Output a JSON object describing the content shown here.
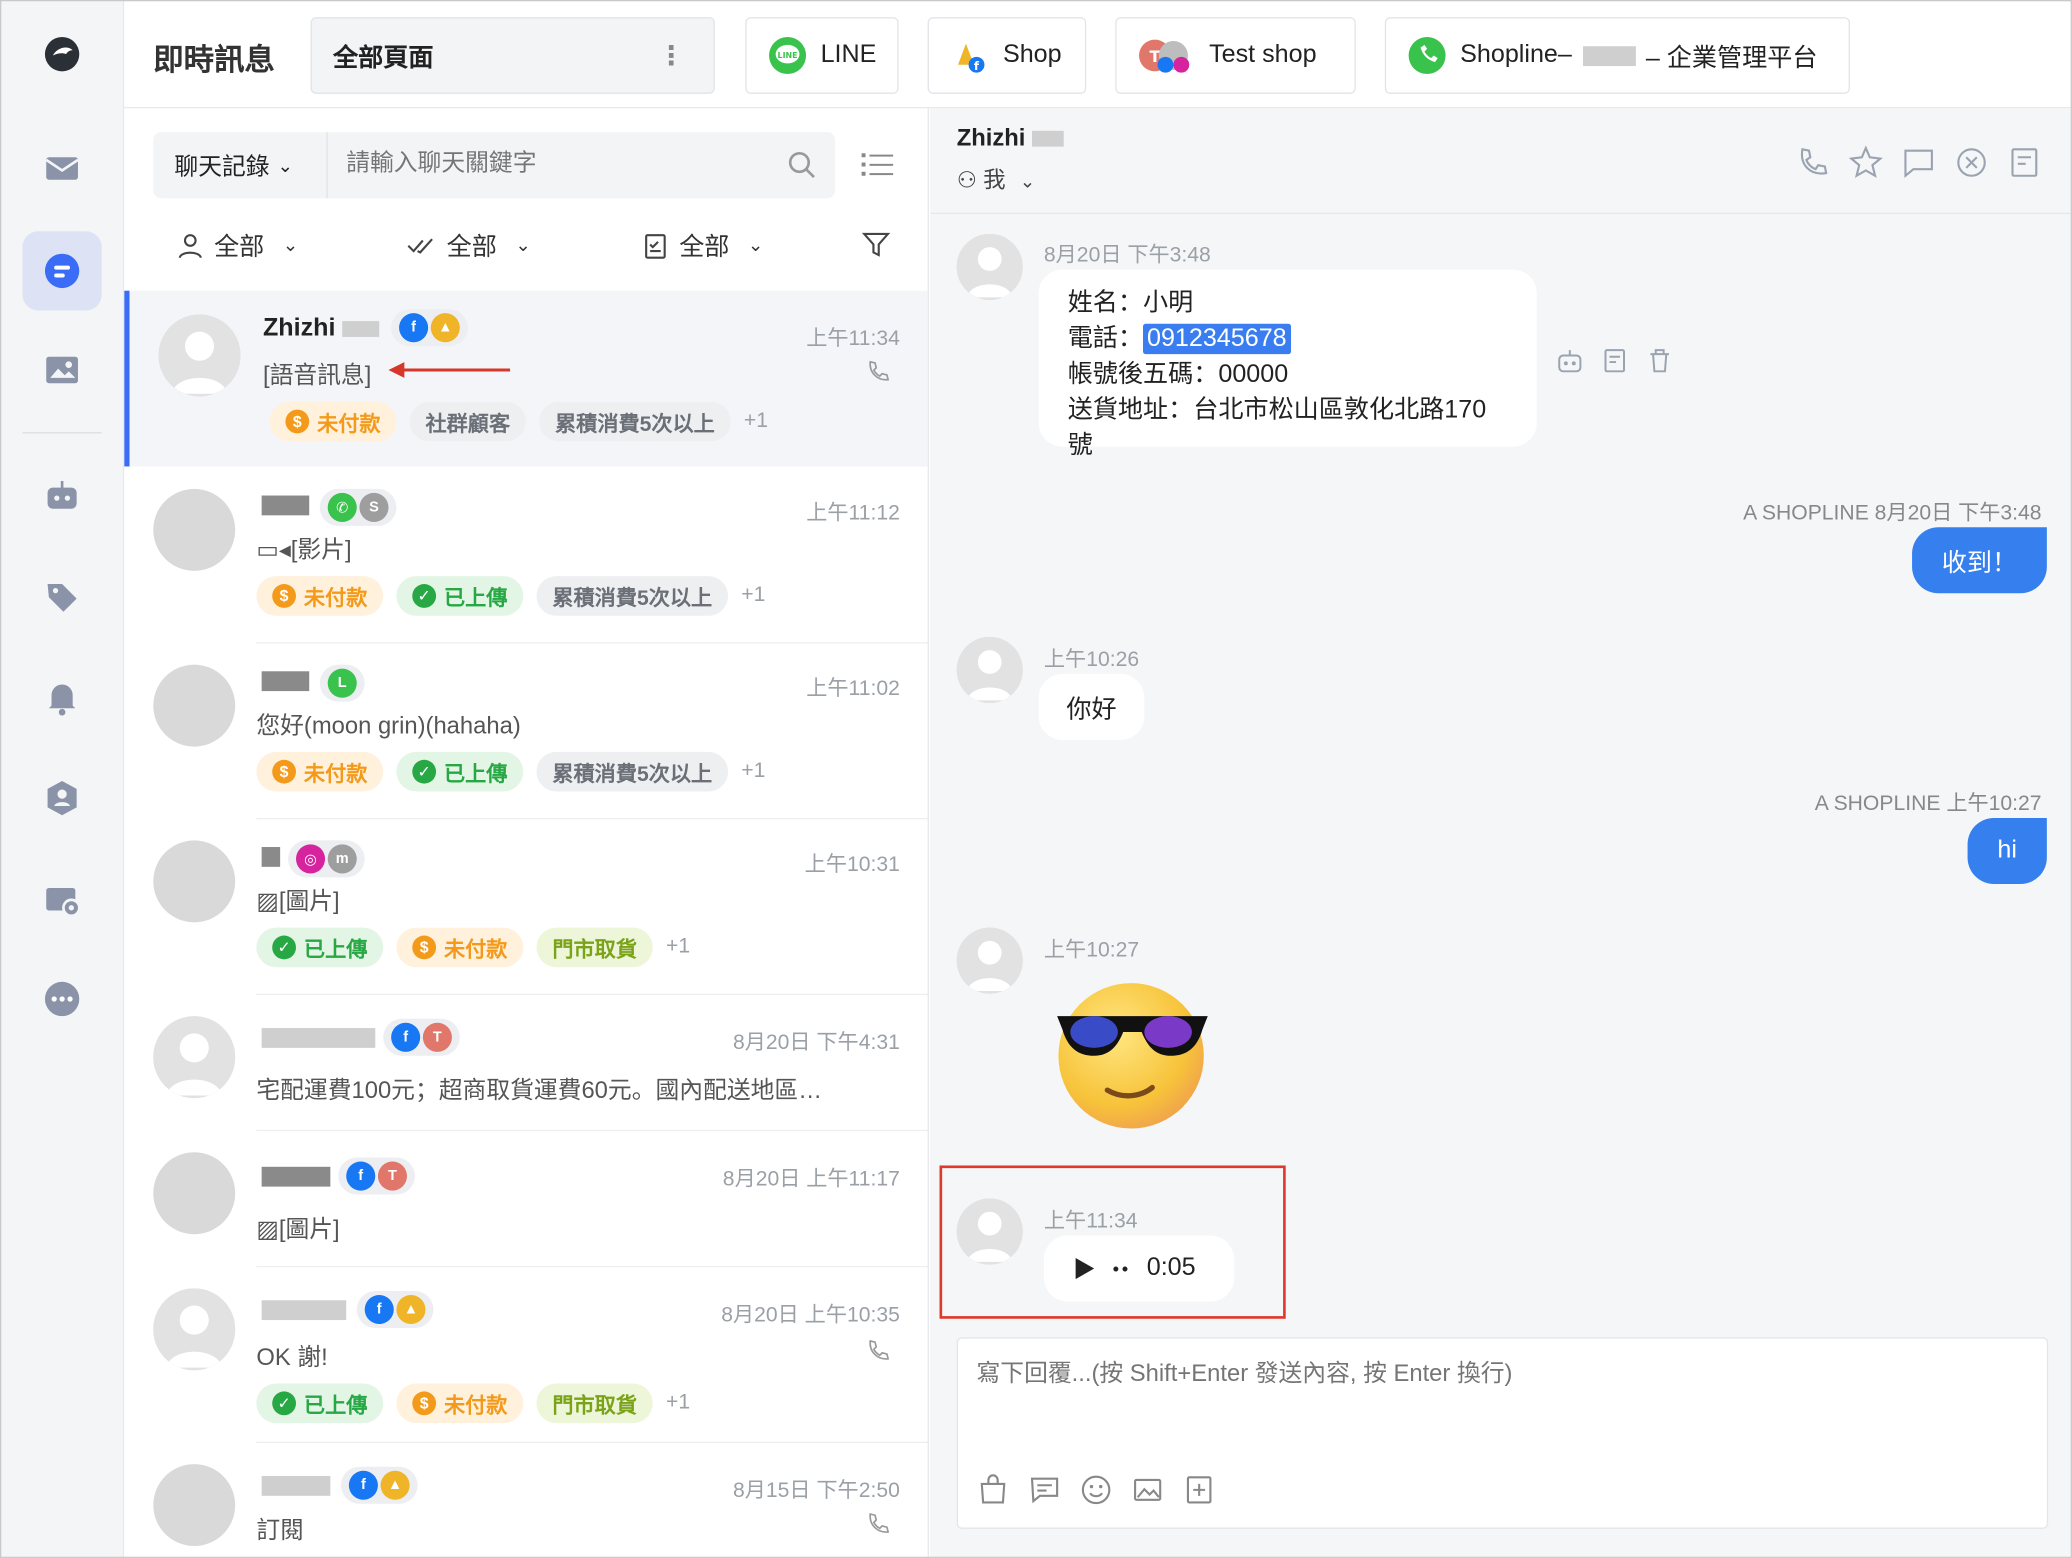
{
  "topbar": {
    "title": "即時訊息",
    "tabs": [
      {
        "label": "全部頁面",
        "icon": "more-vert-icon"
      },
      {
        "label": "LINE",
        "icon": "line-icon"
      },
      {
        "label": "Shop",
        "icon": "shop-icon"
      },
      {
        "label": "Test shop",
        "icon": "test-shop-icon"
      },
      {
        "label_left": "Shopline–",
        "label_right": "– 企業管理平台",
        "icon": "whatsapp-icon"
      }
    ]
  },
  "rail": {
    "items": [
      "logo-icon",
      "mail-icon",
      "chat-icon",
      "image-icon",
      "bot-icon",
      "tag-icon",
      "bell-icon",
      "contact-icon",
      "card-settings-icon",
      "more-icon"
    ],
    "active": "chat-icon"
  },
  "list": {
    "search_select": "聊天記錄",
    "search_placeholder": "請輸入聊天關鍵字",
    "filters": [
      "全部",
      "全部",
      "全部"
    ],
    "items": [
      {
        "name": "Zhizhi",
        "time": "上午11:34",
        "preview": "[語音訊息]",
        "tags": [
          {
            "label": "未付款",
            "type": "orange"
          },
          {
            "label": "社群顧客",
            "type": "gray"
          },
          {
            "label": "累積消費5次以上",
            "type": "gray"
          }
        ],
        "more": "+1"
      },
      {
        "name": "",
        "time": "上午11:12",
        "preview": "[影片]",
        "tags": [
          {
            "label": "未付款",
            "type": "orange"
          },
          {
            "label": "已上傳",
            "type": "green"
          },
          {
            "label": "累積消費5次以上",
            "type": "gray"
          }
        ],
        "more": "+1"
      },
      {
        "name": "",
        "time": "上午11:02",
        "preview": "您好(moon grin)(hahaha)",
        "tags": [
          {
            "label": "未付款",
            "type": "orange"
          },
          {
            "label": "已上傳",
            "type": "green"
          },
          {
            "label": "累積消費5次以上",
            "type": "gray"
          }
        ],
        "more": "+1"
      },
      {
        "name": "",
        "time": "上午10:31",
        "preview": "[圖片]",
        "tags": [
          {
            "label": "已上傳",
            "type": "green"
          },
          {
            "label": "未付款",
            "type": "orange"
          },
          {
            "label": "門市取貨",
            "type": "lime"
          }
        ],
        "more": "+1"
      },
      {
        "name": "",
        "time": "8月20日 下午4:31",
        "preview": "宅配運費100元；超商取貨運費60元。國內配送地區…",
        "tags": [],
        "more": ""
      },
      {
        "name": "",
        "time": "8月20日 上午11:17",
        "preview": "[圖片]",
        "tags": [],
        "more": ""
      },
      {
        "name": "",
        "time": "8月20日 上午10:35",
        "preview": "OK 謝!",
        "tags": [
          {
            "label": "已上傳",
            "type": "green"
          },
          {
            "label": "未付款",
            "type": "orange"
          },
          {
            "label": "門市取貨",
            "type": "lime"
          }
        ],
        "more": "+1"
      },
      {
        "name": "",
        "time": "8月15日 下午2:50",
        "preview": "訂閱",
        "tags": [],
        "more": ""
      }
    ]
  },
  "chat": {
    "name": "Zhizhi",
    "assignee": "我",
    "messages": {
      "m1_time": "8月20日 下午3:48",
      "m1_lines": {
        "name_label": "姓名：",
        "name": "小明",
        "phone_label": "電話：",
        "phone": "0912345678",
        "acct_label": "帳號後五碼：",
        "acct": "00000",
        "addr_label": "送貨地址：",
        "addr": "台北市松山區敦化北路170號"
      },
      "o1_meta": "A SHOPLINE 8月20日 下午3:48",
      "o1_text": "收到！",
      "m2_time": "上午10:26",
      "m2_text": "你好",
      "o2_meta": "A SHOPLINE 上午10:27",
      "o2_text": "hi",
      "m3_time": "上午10:27",
      "m3_sticker": "sunglasses-emoji",
      "m4_time": "上午11:34",
      "m4_duration": "0:05"
    },
    "composer_placeholder": "寫下回覆...(按 Shift+Enter 發送內容, 按 Enter 換行)"
  },
  "colors": {
    "accent": "#3580ee",
    "highlight_box": "#e0392b",
    "unpaid": "#f39a1b",
    "uploaded": "#27a844"
  }
}
